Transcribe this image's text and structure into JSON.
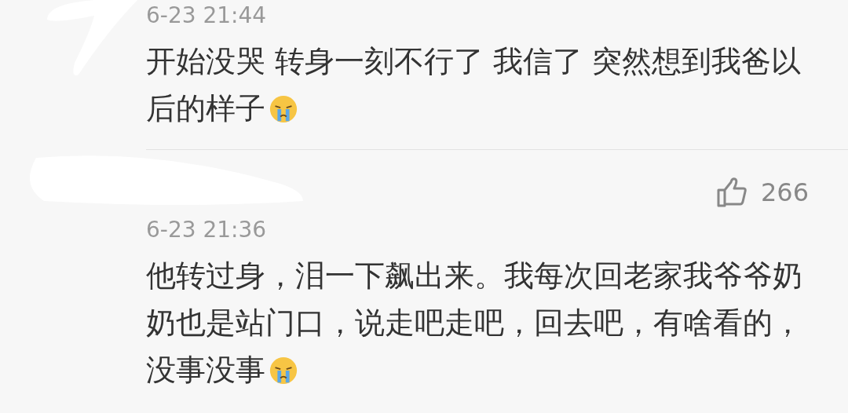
{
  "comments": [
    {
      "time": "6-23 21:44",
      "text": "开始没哭 转身一刻不行了 我信了 突然想到我爸以后的样子",
      "emoji": true
    },
    {
      "likes": "266",
      "time": "6-23 21:36",
      "text": "他转过身，泪一下飙出来。我每次回老家我爷爷奶奶也是站门口，说走吧走吧，回去吧，有啥看的，没事没事",
      "emoji": true
    }
  ]
}
